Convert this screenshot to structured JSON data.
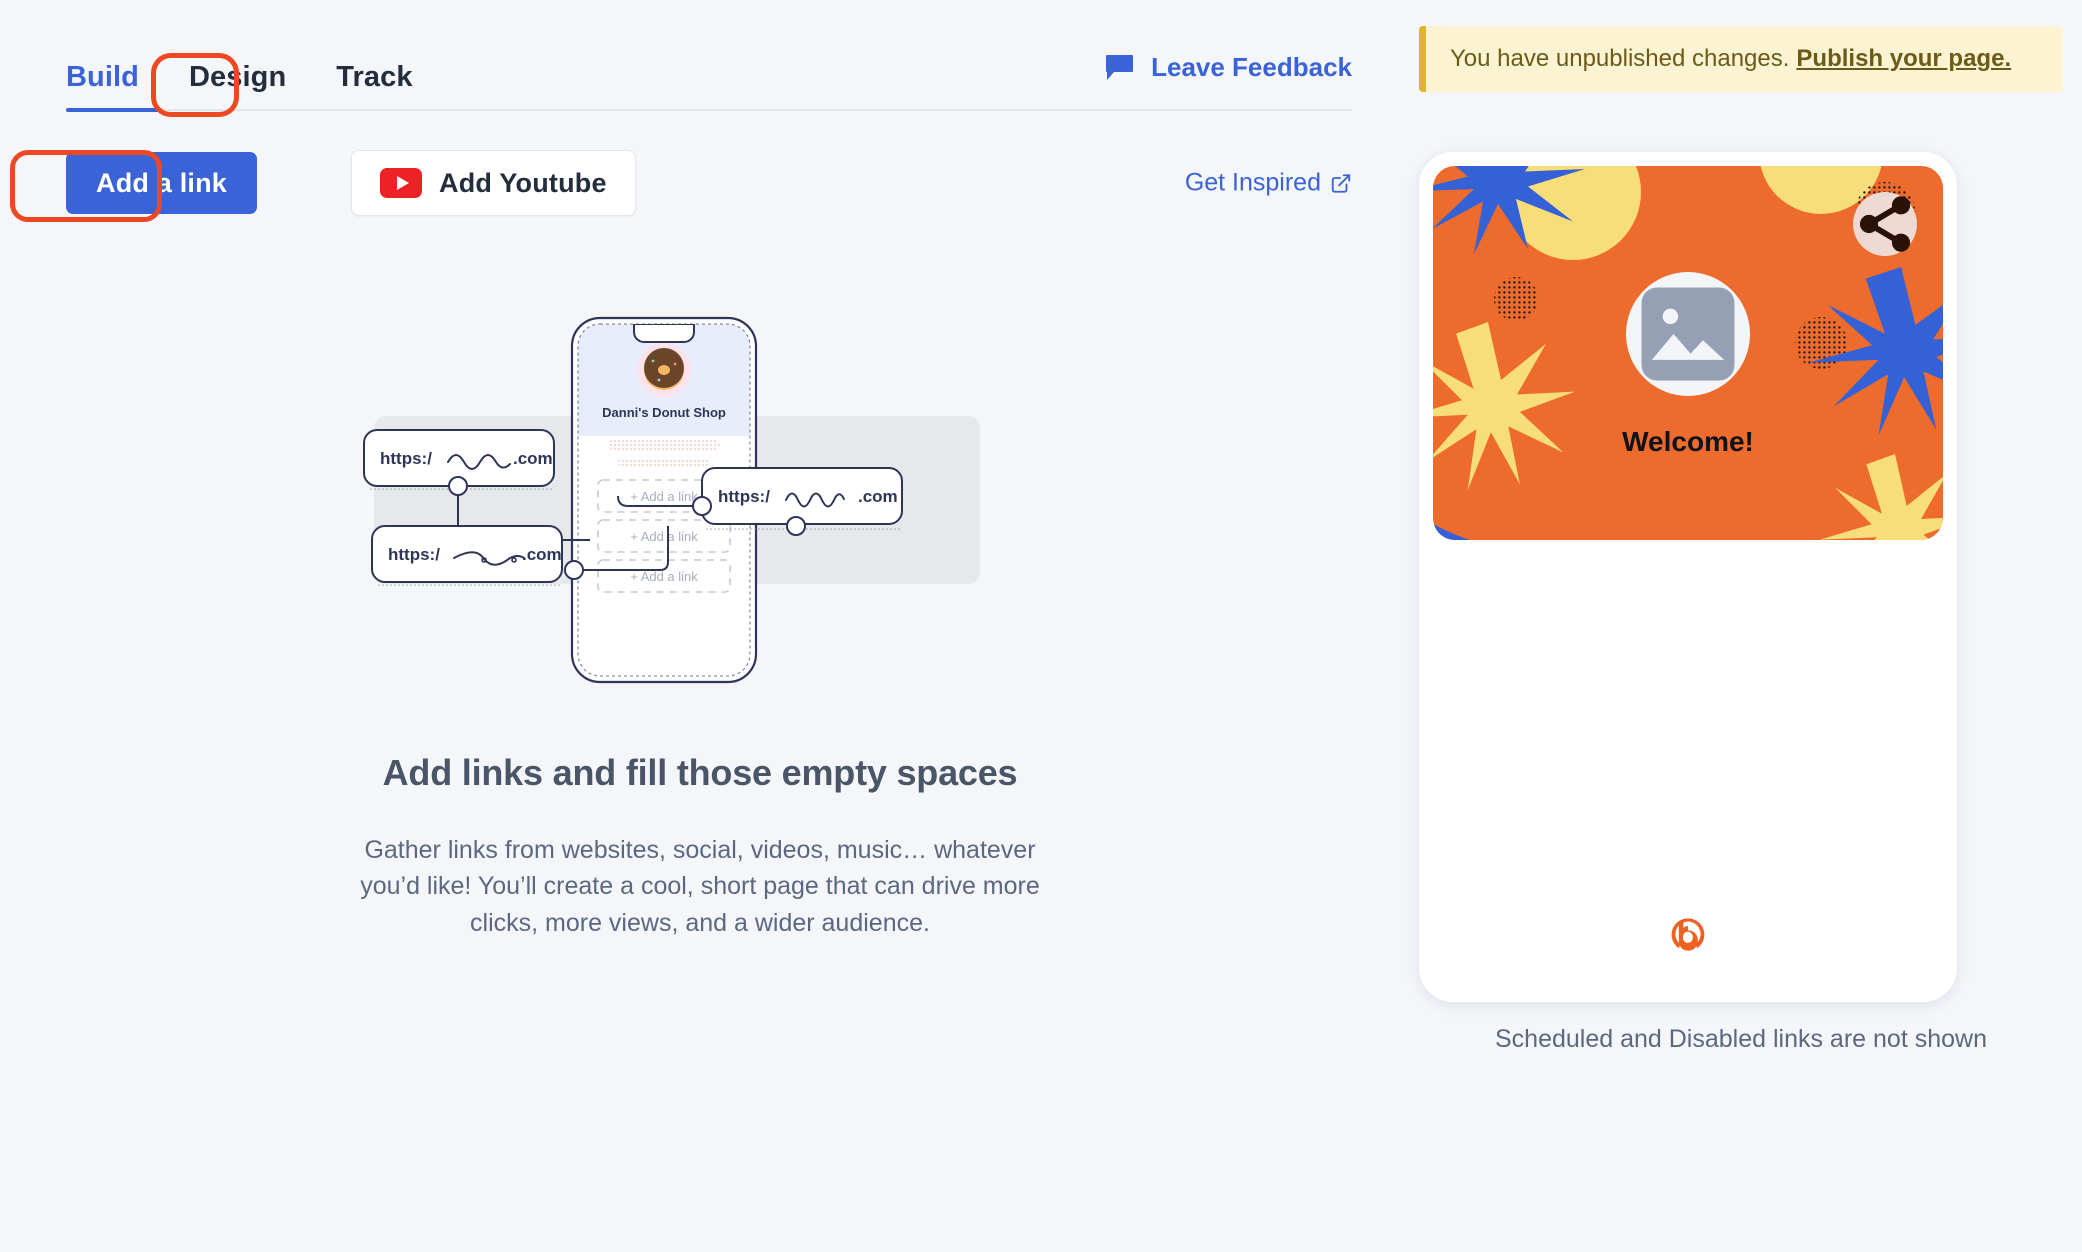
{
  "tabs": [
    {
      "label": "Build",
      "active": true
    },
    {
      "label": "Design",
      "active": false
    },
    {
      "label": "Track",
      "active": false
    }
  ],
  "toolbar": {
    "add_link_label": "Add a link",
    "add_youtube_label": "Add Youtube",
    "youtube_icon": "youtube-play-icon",
    "get_inspired_label": "Get Inspired",
    "get_inspired_icon": "external-link-icon"
  },
  "feedback": {
    "label": "Leave Feedback",
    "icon": "speech-bubble-icon"
  },
  "empty_state": {
    "title": "Add links and fill those empty spaces",
    "body": "Gather links from websites, social, videos, music… whatever you’d like! You’ll create a cool, short page that can drive more clicks, more views, and a wider audience.",
    "illustration": {
      "phone_profile_name": "Danni's Donut Shop",
      "avatar": "donut-image",
      "placeholder_rows": [
        "+ Add a link",
        "+ Add a link",
        "+ Add a link"
      ],
      "url_pills": [
        {
          "prefix": "https:/",
          "suffix": ".com"
        },
        {
          "prefix": "https:/",
          "suffix": ".com"
        },
        {
          "prefix": "https:/",
          "suffix": ".com"
        }
      ]
    }
  },
  "notice": {
    "text": "You have unpublished changes.",
    "link_label": "Publish your page."
  },
  "preview": {
    "welcome_text": "Welcome!",
    "avatar_icon": "image-placeholder-icon",
    "share_icon": "share-icon",
    "brand_logo": "bitly-b-logo",
    "footnote": "Scheduled and Disabled links are not shown"
  },
  "colors": {
    "accent_blue": "#3A63D8",
    "banner_orange": "#EC6B2D",
    "banner_blue": "#3461D6",
    "banner_yellow": "#F7DE78",
    "annotation_red": "#EE4823",
    "notice_bg": "#FCF3D3",
    "notice_border": "#E0B430",
    "youtube_red": "#EC2227",
    "page_bg": "#F4F6FA"
  }
}
